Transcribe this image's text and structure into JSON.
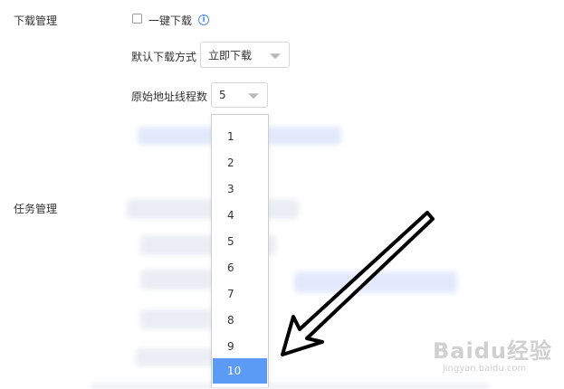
{
  "download": {
    "section_label": "下载管理",
    "one_click_label": "一键下载",
    "info_glyph": "i",
    "default_method_label": "默认下载方式",
    "default_method_value": "立即下载",
    "threads_label": "原始地址线程数",
    "threads_value": "5"
  },
  "dropdown": {
    "options": [
      "1",
      "2",
      "3",
      "4",
      "5",
      "6",
      "7",
      "8",
      "9",
      "10"
    ],
    "selected": "10"
  },
  "task": {
    "section_label": "任务管理"
  },
  "annotation": {
    "arrow_color": "#000000"
  },
  "watermark": {
    "brand": "Baidu经验",
    "url": "jingyan.baidu.com"
  },
  "colors": {
    "accent": "#4a8ef0",
    "selected_bg": "#5b9bf6"
  }
}
